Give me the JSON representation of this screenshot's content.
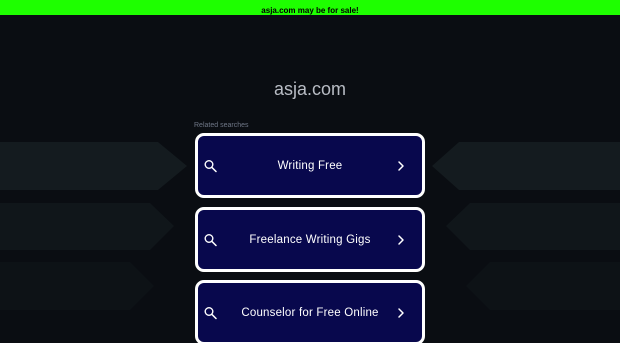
{
  "banner": {
    "text": "asja.com may be for sale!"
  },
  "domain": "asja.com",
  "related_label": "Related searches",
  "items": [
    {
      "label": "Writing Free"
    },
    {
      "label": "Freelance Writing Gigs"
    },
    {
      "label": "Counselor for Free Online"
    }
  ],
  "colors": {
    "banner_bg": "#1eff00",
    "page_bg": "#0a0d12",
    "item_bg": "#08084d",
    "item_border": "#ffffff"
  },
  "icons": {
    "item_left": "search-icon",
    "item_right": "chevron-right-icon"
  }
}
